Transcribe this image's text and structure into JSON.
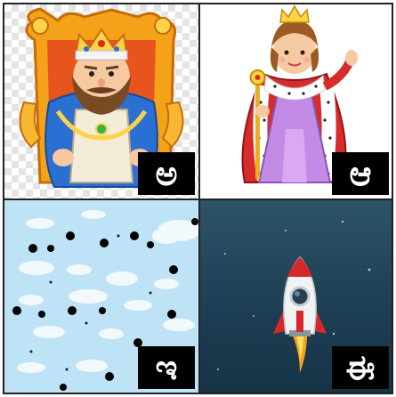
{
  "tiles": [
    {
      "id": "king",
      "letter": "ಅ"
    },
    {
      "id": "queen",
      "letter": "ಆ"
    },
    {
      "id": "sky",
      "letter": "ಇ"
    },
    {
      "id": "rocket",
      "letter": "ಈ"
    }
  ]
}
